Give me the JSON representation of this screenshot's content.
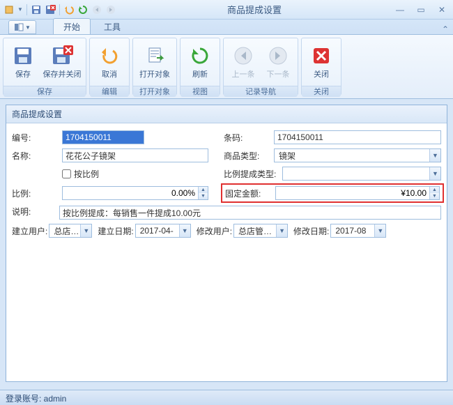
{
  "window": {
    "title": "商品提成设置"
  },
  "tabs": {
    "start": "开始",
    "tools": "工具"
  },
  "ribbon": {
    "save": "保存",
    "save_close": "保存并关闭",
    "cancel": "取消",
    "open_obj": "打开对象",
    "refresh": "刷新",
    "prev": "上一条",
    "next": "下一条",
    "close": "关闭",
    "grp_save": "保存",
    "grp_edit": "编辑",
    "grp_open": "打开对象",
    "grp_view": "视图",
    "grp_nav": "记录导航",
    "grp_close": "关闭"
  },
  "form": {
    "title": "商品提成设置",
    "code_lbl": "编号:",
    "code_val": "1704150011",
    "barcode_lbl": "条码:",
    "barcode_val": "1704150011",
    "name_lbl": "名称:",
    "name_val": "花花公子镜架",
    "ptype_lbl": "商品类型:",
    "ptype_val": "镜架",
    "byratio_lbl": "按比例",
    "ctype_lbl": "比例提成类型:",
    "ctype_val": "",
    "ratio_lbl": "比例:",
    "ratio_val": "0.00%",
    "fixed_lbl": "固定金额:",
    "fixed_val": "¥10.00",
    "desc_lbl": "说明:",
    "desc_val": "按比例提成：每销售一件提成10.00元",
    "create_user_lbl": "建立用户:",
    "create_user_val": "总店…",
    "create_date_lbl": "建立日期:",
    "create_date_val": "2017-04-",
    "mod_user_lbl": "修改用户:",
    "mod_user_val": "总店管…",
    "mod_date_lbl": "修改日期:",
    "mod_date_val": "2017-08"
  },
  "status": {
    "login": "登录账号: admin"
  }
}
